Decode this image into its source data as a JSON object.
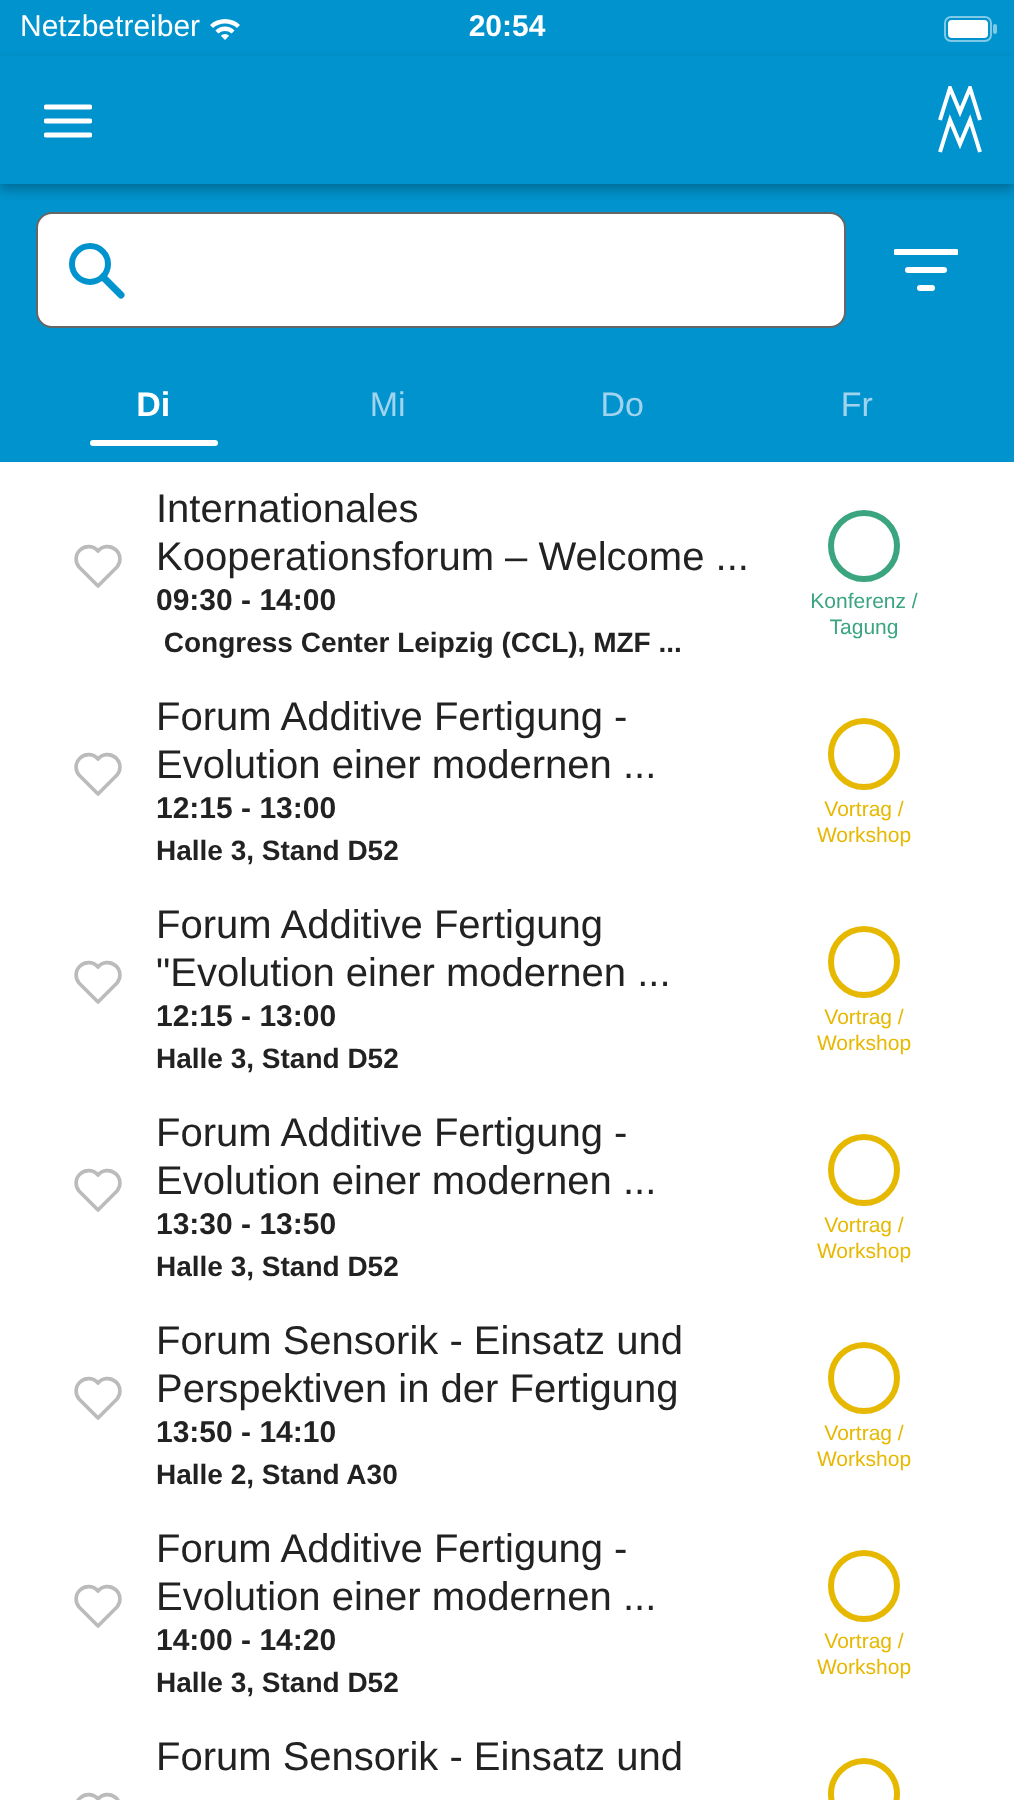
{
  "status_bar": {
    "carrier": "Netzbetreiber",
    "time": "20:54"
  },
  "tabs": [
    {
      "label": "Di",
      "selected": true
    },
    {
      "label": "Mi",
      "selected": false
    },
    {
      "label": "Do",
      "selected": false
    },
    {
      "label": "Fr",
      "selected": false
    }
  ],
  "events": [
    {
      "title": "Internationales Kooperationsforum – Welcome ...",
      "time": "09:30 - 14:00",
      "location": " Congress Center Leipzig (CCL), MZF ...",
      "category": "Konferenz / Tagung",
      "color": "#3aa57f",
      "favorite": false
    },
    {
      "title": "Forum Additive Fertigung - Evolution einer modernen ...",
      "time": "12:15 - 13:00",
      "location": "Halle 3, Stand D52",
      "category": "Vortrag / Workshop",
      "color": "#e6b800",
      "favorite": false
    },
    {
      "title": "Forum Additive Fertigung \"Evolution einer modernen ...",
      "time": "12:15 - 13:00",
      "location": "Halle 3, Stand D52",
      "category": "Vortrag / Workshop",
      "color": "#e6b800",
      "favorite": false
    },
    {
      "title": "Forum Additive Fertigung - Evolution einer modernen ...",
      "time": "13:30 - 13:50",
      "location": "Halle 3, Stand D52",
      "category": "Vortrag / Workshop",
      "color": "#e6b800",
      "favorite": false
    },
    {
      "title": "Forum Sensorik - Einsatz und Perspektiven in der Fertigung",
      "time": "13:50 - 14:10",
      "location": "Halle 2, Stand A30",
      "category": "Vortrag / Workshop",
      "color": "#e6b800",
      "favorite": false
    },
    {
      "title": "Forum Additive Fertigung - Evolution einer modernen ...",
      "time": "14:00 - 14:20",
      "location": "Halle 3, Stand D52",
      "category": "Vortrag / Workshop",
      "color": "#e6b800",
      "favorite": false
    },
    {
      "title": "Forum Sensorik - Einsatz und",
      "favorite": false,
      "color": "#e6b800"
    }
  ]
}
